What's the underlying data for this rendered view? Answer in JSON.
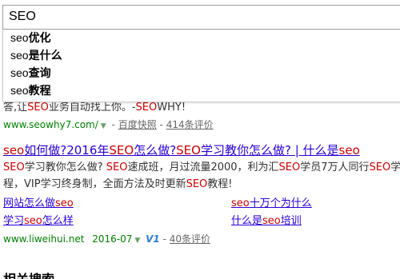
{
  "search": {
    "value": "SEO"
  },
  "suggestions": [
    {
      "prefix": "seo",
      "bold": "优化"
    },
    {
      "prefix": "seo",
      "bold": "是什么"
    },
    {
      "prefix": "seo",
      "bold": "查询"
    },
    {
      "prefix": "seo",
      "bold": "教程"
    }
  ],
  "result1": {
    "abstract_a": "答,让",
    "abstract_hl1": "SEO",
    "abstract_b": "业务自动找上你。-",
    "abstract_hl2": "SEO",
    "abstract_c": "WHY!",
    "url": "www.seowhy7.com/",
    "sep1": "-",
    "cache": "百度快照",
    "sep2": "-",
    "reviews": "414条评价"
  },
  "result2": {
    "title": {
      "p1": "seo",
      "p2": "如何做?2016年",
      "p3": "SEO",
      "p4": "怎么做?",
      "p5": "SEO",
      "p6": "学习教你怎么做? | 什么是",
      "p7": "seo"
    },
    "abstract": {
      "l1a": "SEO",
      "l1b": "学习教你怎么做? ",
      "l1c": "SEO",
      "l1d": "速成班，月过流量2000，利为汇",
      "l1e": "SEO",
      "l1f": "学员7万人同行",
      "l1g": "SEO",
      "l1h": "学",
      "l2a": "程，VIP学习终身制，全面方法及时更新",
      "l2b": "SEO",
      "l2c": "教程!"
    },
    "sublinks": [
      {
        "a": "网站怎么做",
        "b": "seo",
        "c": ""
      },
      {
        "a": "",
        "b": "seo",
        "c": "十万个为什么"
      },
      {
        "a": "学习",
        "b": "seo",
        "c": "怎么样"
      },
      {
        "a": "什么是",
        "b": "seo",
        "c": "培训"
      }
    ],
    "url": "www.liweihui.net",
    "date": "2016-07",
    "badge": "V1",
    "sep": "-",
    "reviews": "40条评价"
  },
  "related": {
    "heading": "相关搜索"
  },
  "colors": {
    "link": "#2a00d4",
    "highlight": "#cc0000",
    "url_green": "#008000",
    "v1_blue": "#2e7bd6"
  },
  "icons": {
    "url_dropdown": "dropdown-arrow-icon",
    "v1_badge": "v1-certification-icon"
  }
}
